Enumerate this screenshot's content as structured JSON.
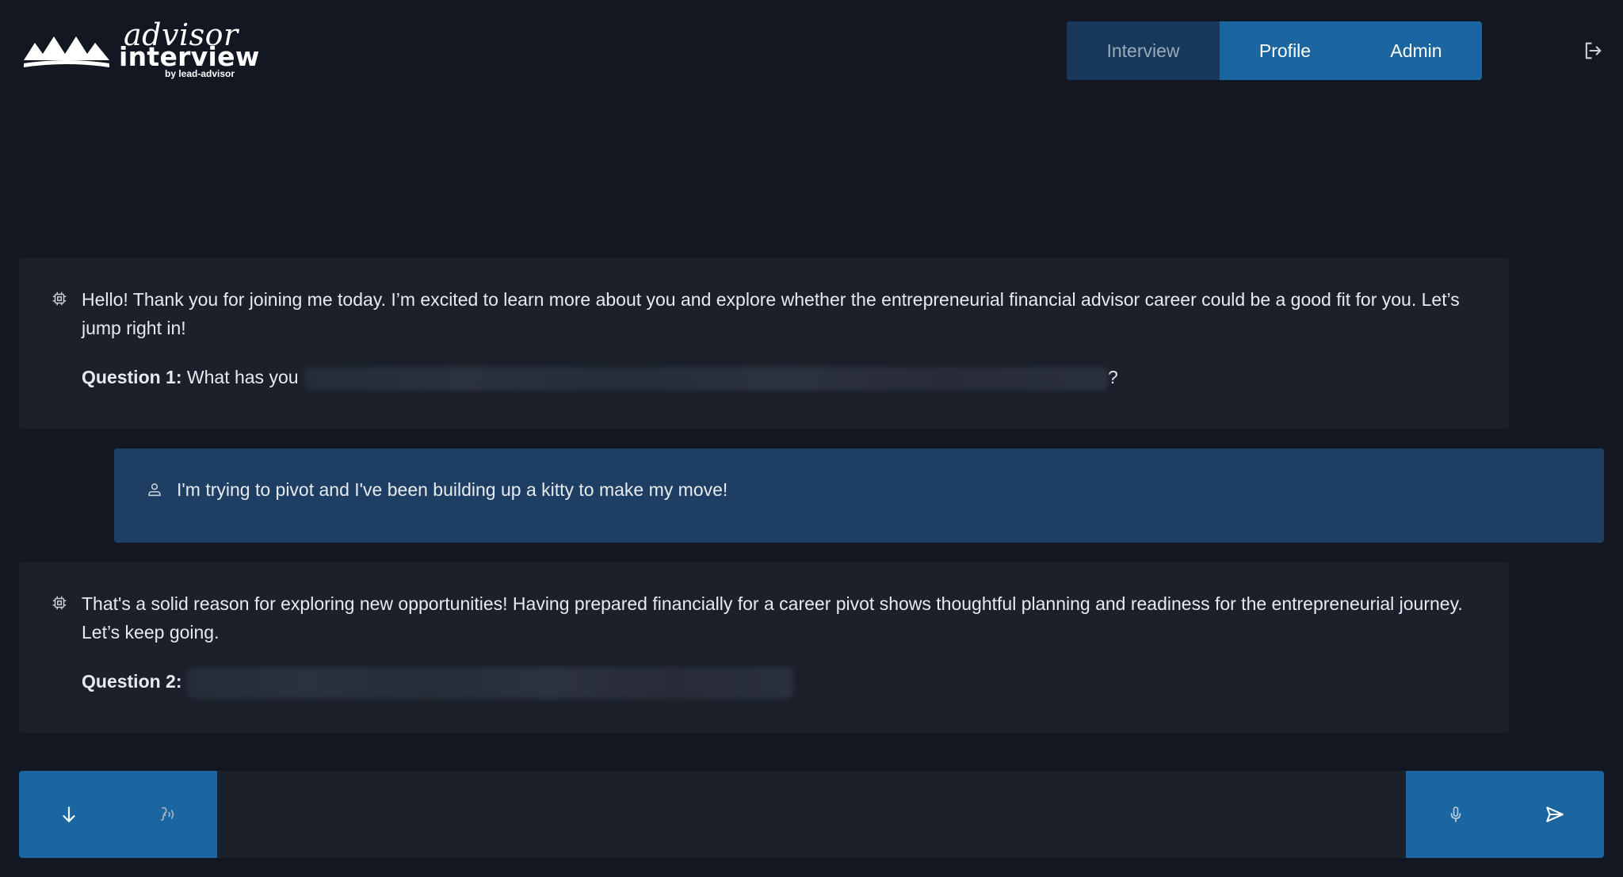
{
  "header": {
    "logo": {
      "script_text": "advisor",
      "word_text": "interview",
      "byline": "by lead-advisor"
    },
    "tabs": [
      {
        "label": "Interview",
        "active": false
      },
      {
        "label": "Profile",
        "active": true
      },
      {
        "label": "Admin",
        "active": true
      }
    ],
    "logout_icon": "logout-icon"
  },
  "conversation": [
    {
      "role": "assistant",
      "icon": "cpu-chip-icon",
      "text": "Hello! Thank you for joining me today. I’m excited to learn more about you and explore whether the entrepreneurial financial advisor career could be a good fit for you. Let’s jump right in!",
      "question_label": "Question 1:",
      "question_text": "What has you",
      "question_suffix": "?"
    },
    {
      "role": "user",
      "icon": "user-icon",
      "text": "I'm trying to pivot and I've been building up a kitty to make my move!"
    },
    {
      "role": "assistant",
      "icon": "cpu-chip-icon",
      "text": "That's a solid reason for exploring new opportunities! Having prepared financially for a career pivot shows thoughtful planning and readiness for the entrepreneurial journey. Let’s keep going.",
      "question_label": "Question 2:",
      "question_text": ""
    }
  ],
  "composer": {
    "input_value": "",
    "buttons": [
      {
        "icon": "arrow-down-icon"
      },
      {
        "icon": "voice-icon"
      },
      {
        "icon": "microphone-icon"
      },
      {
        "icon": "send-icon"
      }
    ]
  },
  "colors": {
    "background": "#121722",
    "bot_bubble": "#1b202b",
    "user_bubble": "#1e3f63",
    "accent": "#1b66a0",
    "tab_inactive": "#17385a"
  }
}
